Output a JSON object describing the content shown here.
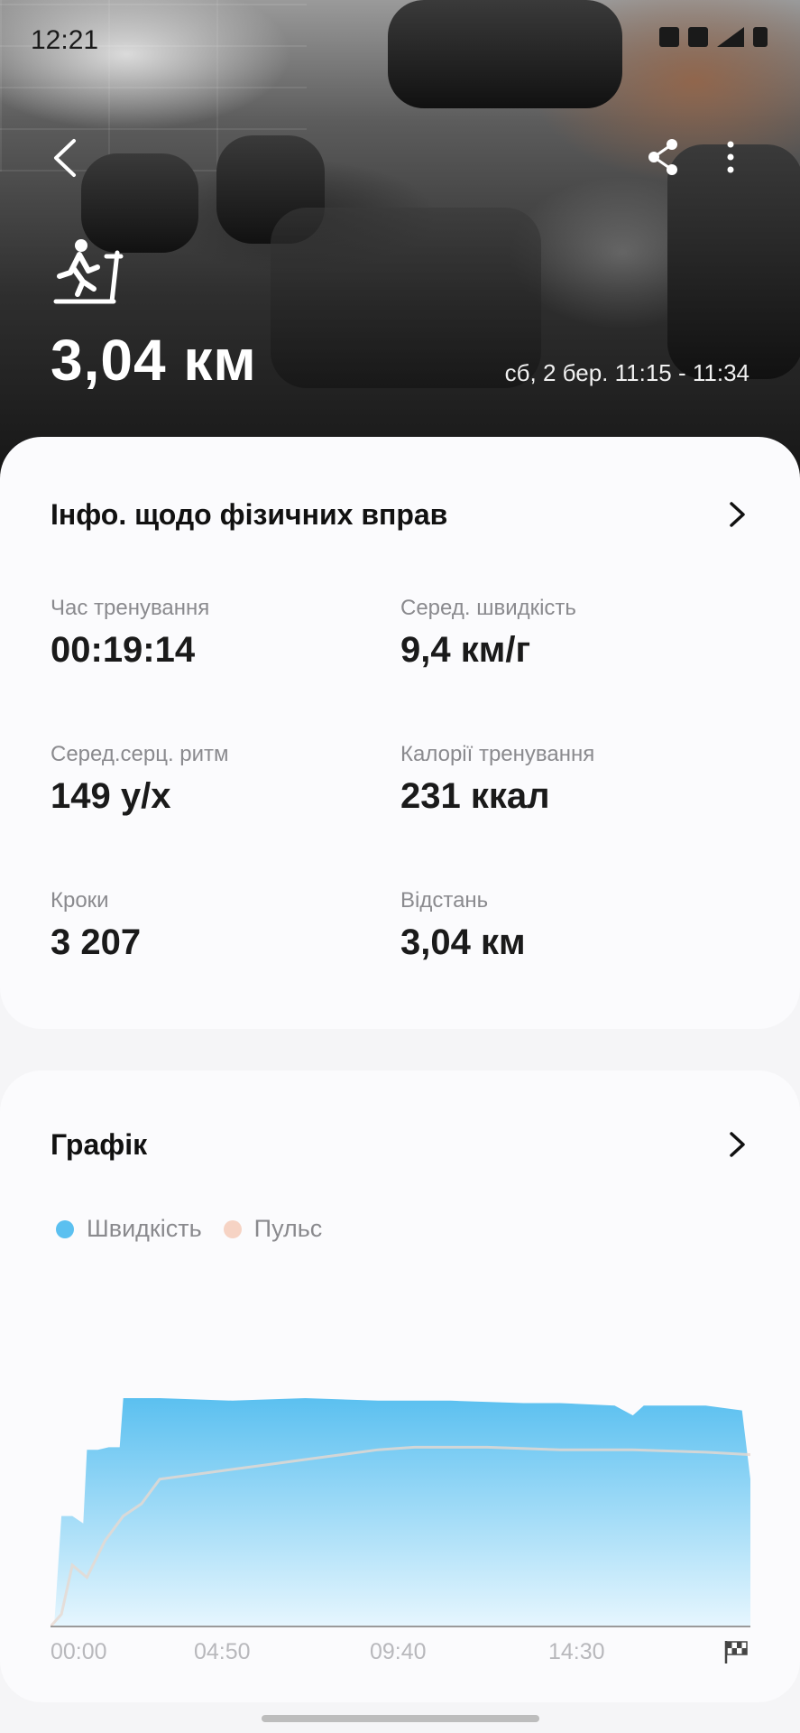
{
  "status_bar": {
    "time": "12:21"
  },
  "hero": {
    "distance": "3,04 км",
    "datetime": "сб, 2 бер. 11:15 - 11:34",
    "activity_icon": "treadmill-icon"
  },
  "info_card": {
    "title": "Інфо. щодо фізичних вправ",
    "metrics": [
      {
        "label": "Час тренування",
        "value": "00:19:14"
      },
      {
        "label": "Серед. швидкість",
        "value": "9,4 км/г"
      },
      {
        "label": "Серед.серц. ритм",
        "value": "149 у/х"
      },
      {
        "label": "Калорії тренування",
        "value": "231 ккал"
      },
      {
        "label": "Кроки",
        "value": "3 207"
      },
      {
        "label": "Відстань",
        "value": "3,04 км"
      }
    ]
  },
  "graph_card": {
    "title": "Графік",
    "legend": [
      {
        "label": "Швидкість",
        "color": "#5bc0f0"
      },
      {
        "label": "Пульс",
        "color": "#f6d3c4"
      }
    ],
    "x_ticks": [
      "00:00",
      "04:50",
      "09:40",
      "14:30"
    ],
    "finish_icon": "checkered-flag-icon"
  },
  "chart_data": {
    "type": "area",
    "x_labels": [
      "00:00",
      "04:50",
      "09:40",
      "14:30"
    ],
    "x_range_min": [
      0,
      19.23
    ],
    "series": [
      {
        "name": "Швидкість",
        "x_min": [
          0,
          0.1,
          0.3,
          0.6,
          0.9,
          1.0,
          1.3,
          1.6,
          1.9,
          2.0,
          3.0,
          5.0,
          7.0,
          9.0,
          11.0,
          13.0,
          14.0,
          15.5,
          16.0,
          16.3,
          17.0,
          18.0,
          19.0,
          19.23
        ],
        "values": [
          0,
          0,
          0.45,
          0.45,
          0.42,
          0.72,
          0.72,
          0.73,
          0.73,
          0.93,
          0.93,
          0.92,
          0.93,
          0.92,
          0.92,
          0.91,
          0.91,
          0.9,
          0.86,
          0.9,
          0.9,
          0.9,
          0.88,
          0.6
        ]
      },
      {
        "name": "Пульс",
        "x_min": [
          0,
          0.3,
          0.6,
          1.0,
          1.5,
          2.0,
          2.5,
          3.0,
          4.0,
          5.0,
          6.0,
          7.0,
          8.0,
          9.0,
          10.0,
          12.0,
          14.0,
          16.0,
          18.0,
          19.23
        ],
        "values": [
          0,
          0.05,
          0.25,
          0.2,
          0.35,
          0.45,
          0.5,
          0.6,
          0.62,
          0.64,
          0.66,
          0.68,
          0.7,
          0.72,
          0.73,
          0.73,
          0.72,
          0.72,
          0.71,
          0.7
        ]
      }
    ]
  }
}
